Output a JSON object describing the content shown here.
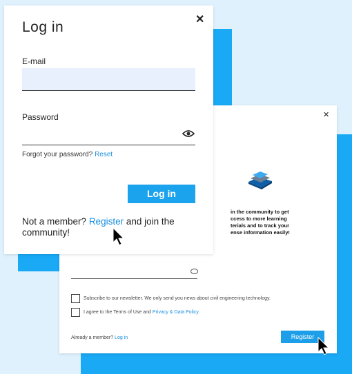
{
  "login": {
    "title": "Log in",
    "close_symbol": "✕",
    "email_label": "E-mail",
    "email_value": "",
    "password_label": "Password",
    "password_value": "",
    "eye_icon": "eye-icon",
    "forgot_text": "Forgot your password?",
    "reset_link": "Reset",
    "login_button": "Log in",
    "not_member_text": "Not a member?",
    "register_link": "Register",
    "join_text": "and join the community!"
  },
  "register": {
    "close_symbol": "✕",
    "logo_icon": "stacked-layers-icon",
    "promo_lines": [
      "in the community to get",
      "ccess to more learning",
      "terials and to track your",
      "ense information easily!"
    ],
    "newsletter_text": "Subscribe to our newsletter. We only send you news about civil engineering technology.",
    "terms_text": "I agree to the Terms of Use and",
    "privacy_link": "Privacy & Data Policy",
    "terms_end": ".",
    "already_text": "Already a member?",
    "login_link": "Log in",
    "register_button": "Register"
  },
  "colors": {
    "accent": "#1aa9f5",
    "button": "#1ba3ee",
    "link": "#1a8fdf",
    "input_fill": "#e8f0fe",
    "background": "#dff1fc"
  }
}
